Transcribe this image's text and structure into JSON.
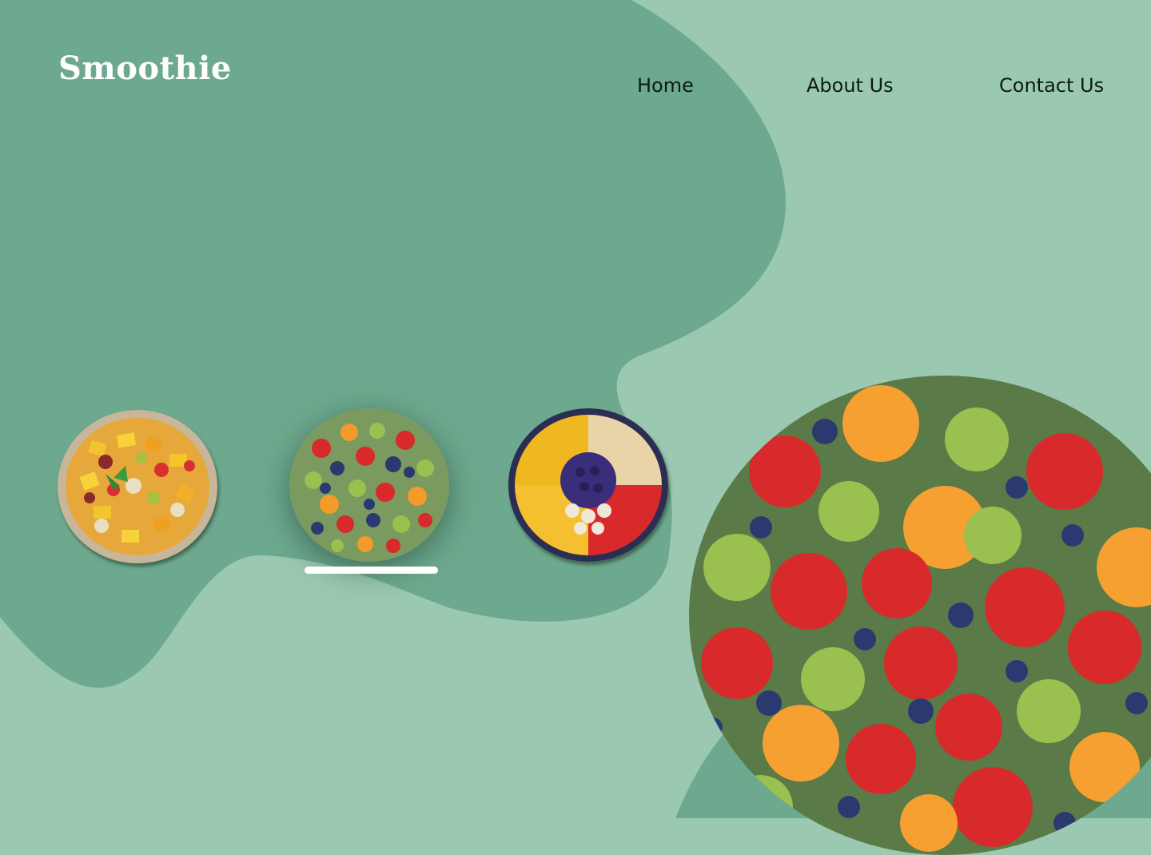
{
  "brand": {
    "logo_text": "Smoothie"
  },
  "nav": {
    "items": [
      {
        "label": "Home"
      },
      {
        "label": "About Us"
      },
      {
        "label": "Contact Us"
      }
    ]
  },
  "gallery": {
    "active_index": 1,
    "thumbnails": [
      {
        "icon": "fruit-salad-bowl-image"
      },
      {
        "icon": "mixed-berry-platter-image"
      },
      {
        "icon": "fruit-arrangement-bowl-image"
      }
    ]
  },
  "hero": {
    "icon": "featured-fruit-platter-image"
  },
  "colors": {
    "background_light": "#9bc8b1",
    "blob_dark": "#6da98e",
    "logo": "#ffffff",
    "nav_text": "#0d1a12",
    "active_indicator": "#ffffff"
  }
}
